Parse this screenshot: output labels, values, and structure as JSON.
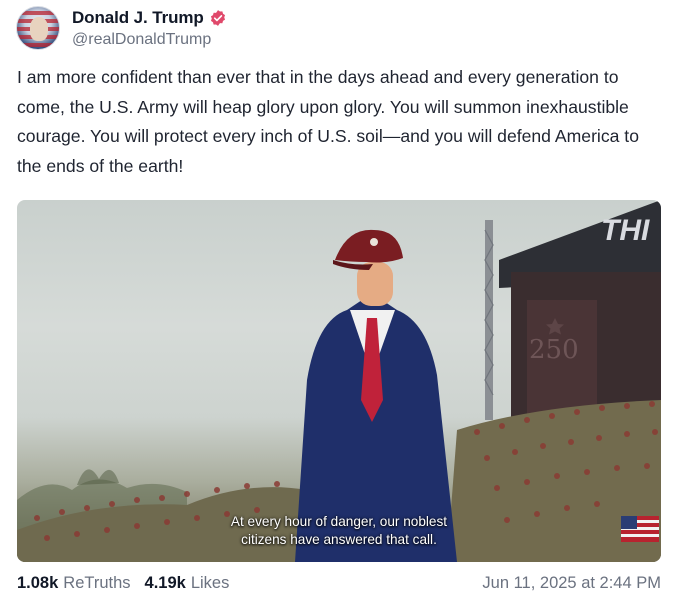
{
  "author": {
    "display_name": "Donald J. Trump",
    "handle": "@realDonaldTrump",
    "verified_icon": "verified-badge-icon",
    "verified_color": "#e0496b"
  },
  "post": {
    "text": "I am more confident than ever that in the days ahead and every generation to come, the U.S. Army will heap glory upon glory. You will summon inexhaustible courage. You will protect every inch of U.S. soil—and you will defend America to the ends of the earth!"
  },
  "media": {
    "type": "video",
    "caption_line1": "At every hour of danger, our noblest",
    "caption_line2": "citizens have answered that call.",
    "stage_sign_text": "THI",
    "banner_text": "250"
  },
  "stats": {
    "retruths_count": "1.08k",
    "retruths_label": "ReTruths",
    "likes_count": "4.19k",
    "likes_label": "Likes",
    "timestamp": "Jun 11, 2025 at 2:44 PM"
  }
}
